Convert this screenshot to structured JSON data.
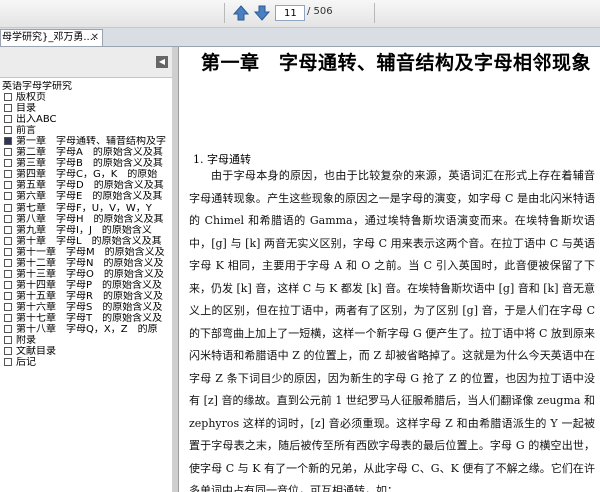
{
  "toolbar": {
    "current_page": "11",
    "total_pages": "/ 506",
    "prev_icon": "arrow-up-icon",
    "next_icon": "arrow-down-icon"
  },
  "tab": {
    "title": "母学研究}_邓万勇.... ",
    "close_label": "✕"
  },
  "sidebar": {
    "root": "英语字母学研究",
    "items": [
      {
        "label": "版权页"
      },
      {
        "label": "目录"
      },
      {
        "label": "出入ABC"
      },
      {
        "label": "前言"
      },
      {
        "label": "第一章　字母通转、辅音结构及字"
      },
      {
        "label": "第二章　字母A　的原始含义及其"
      },
      {
        "label": "第三章　字母B　的原始含义及其"
      },
      {
        "label": "第四章　字母C，G，K　的原始"
      },
      {
        "label": "第五章　字母D　的原始含义及其"
      },
      {
        "label": "第六章　字母E　的原始含义及其"
      },
      {
        "label": "第七章　字母F，U，V，W，Y"
      },
      {
        "label": "第八章　字母H　的原始含义及其"
      },
      {
        "label": "第九章　字母I，J　的原始含义"
      },
      {
        "label": "第十章　字母L　的原始含义及其"
      },
      {
        "label": "第十一章　字母M　的原始含义及"
      },
      {
        "label": "第十二章　字母N　的原始含义及"
      },
      {
        "label": "第十三章　字母O　的原始含义及"
      },
      {
        "label": "第十四章　字母P　的原始含义及"
      },
      {
        "label": "第十五章　字母R　的原始含义及"
      },
      {
        "label": "第十六章　字母S　的原始含义及"
      },
      {
        "label": "第十七章　字母T　的原始含义及"
      },
      {
        "label": "第十八章　字母Q，X，Z　的原"
      },
      {
        "label": "附录"
      },
      {
        "label": "文献目录"
      },
      {
        "label": "后记"
      }
    ],
    "selected_index": 4
  },
  "document": {
    "chapter_title": "第一章　字母通转、辅音结构及字母相邻现象",
    "section_title": "1. 字母通转",
    "paragraph_1": "由于字母本身的原因，也由于比较复杂的来源，英语词汇在形式上存在着辅音字母通转现象。产生这些现象的原因之一是字母的演变，如字母 C 是由北闪米特语的 Chimel 和希腊语的 Gamma，通过埃特鲁斯坎语演变而来。在埃特鲁斯坎语中，[g] 与 [k] 两音无实义区别，字母 C 用来表示这两个音。在拉丁语中 C 与英语字母 K 相同，主要用于字母 A 和 O 之前。当 C 引入英国时，此音便被保留了下来，仍发 [k] 音，这样 C 与 K 都发 [k] 音。在埃特鲁斯坎语中 [g] 音和 [k] 音无意义上的区别，但在拉丁语中，两者有了区别，为了区别 [g] 音，于是人们在字母 C 的下部弯曲上加上了一短横，这样一个新字母 G 便产生了。拉丁语中将 C 放到原来闪米特语和希腊语中 Z 的位置上，而 Z 却被省略掉了。这就是为什么今天英语中在字母 Z 条下词目少的原因，因为新生的字母 G 抢了 Z 的位置，也因为拉丁语中没有 [z] 音的缘故。直到公元前 1 世纪罗马人征服希腊后，当人们翻译像 zeugma 和 zephyros 这样的词时，[z] 音必须重现。这样字母 Z 和由希腊语派生的 Y 一起被置于字母表之末，随后被传至所有西欧字母表的最后位置上。字母 G 的横空出世，使字母 C 与 K 有了一个新的兄弟，从此字母 C、G、K 便有了不解之缘。它们在许多单词中占有同一音位，可互相通转，如："
  }
}
